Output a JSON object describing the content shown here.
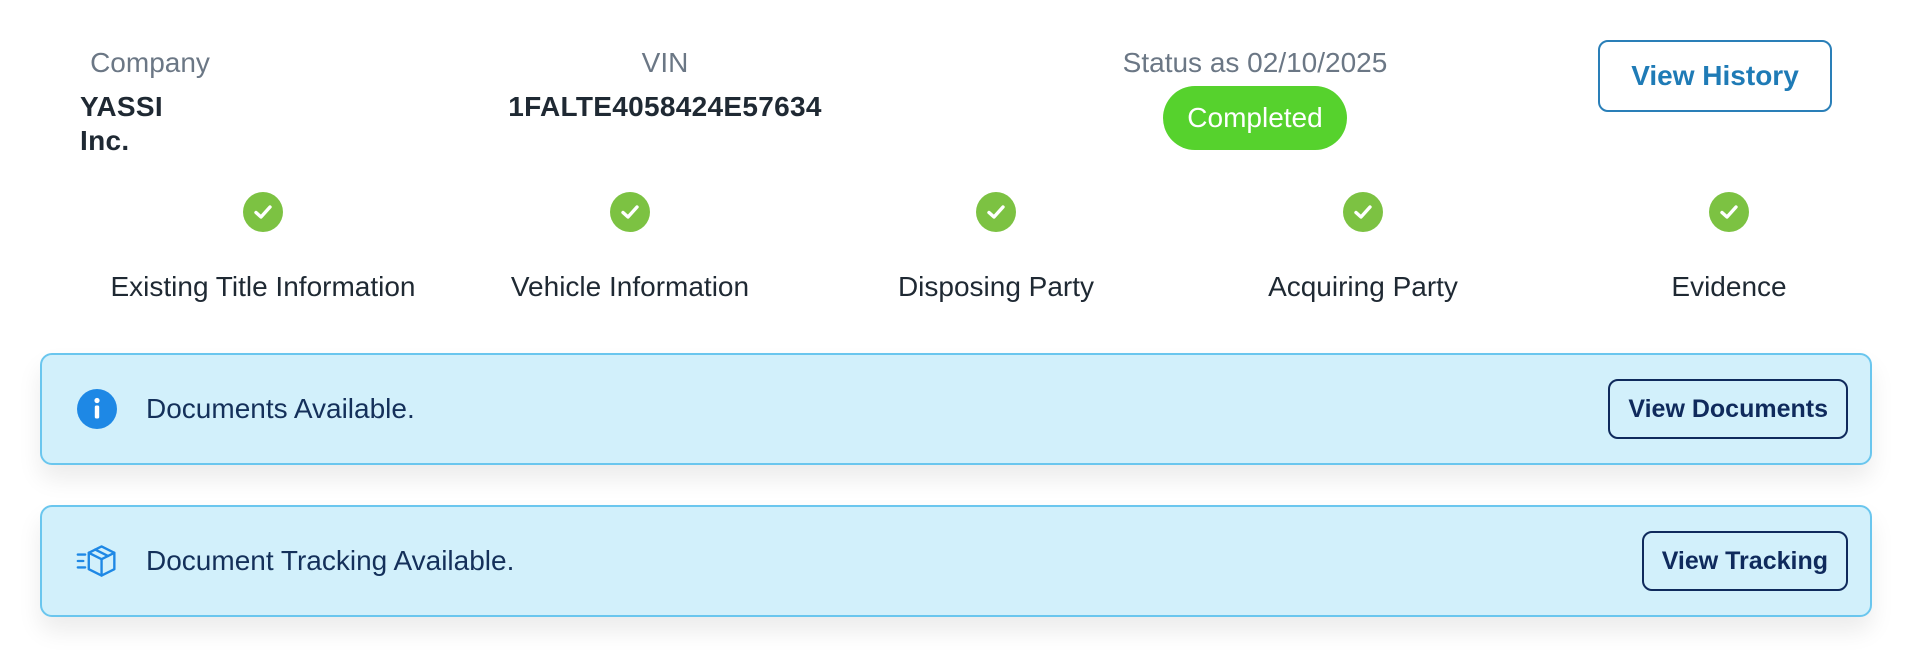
{
  "header": {
    "company_label": "Company",
    "company_value": "YASSI Inc.",
    "vin_label": "VIN",
    "vin_value": "1FALTE4058424E57634",
    "status_label": "Status as 02/10/2025",
    "status_badge": "Completed",
    "view_history_label": "View History"
  },
  "steps": [
    {
      "label": "Existing Title Information",
      "icon": "check-icon",
      "completed": true
    },
    {
      "label": "Vehicle Information",
      "icon": "check-icon",
      "completed": true
    },
    {
      "label": "Disposing Party",
      "icon": "check-icon",
      "completed": true
    },
    {
      "label": "Acquiring Party",
      "icon": "check-icon",
      "completed": true
    },
    {
      "label": "Evidence",
      "icon": "check-icon",
      "completed": true
    }
  ],
  "banners": {
    "documents": {
      "icon": "info-icon",
      "message": "Documents Available.",
      "button_label": "View Documents"
    },
    "tracking": {
      "icon": "package-tracking-icon",
      "message": "Document Tracking Available.",
      "button_label": "View Tracking"
    }
  },
  "colors": {
    "status_completed": "#56d22d",
    "step_check": "#7cc242",
    "banner_bg": "#d2f0fb",
    "banner_border": "#6ac6ee",
    "accent_blue": "#1f7bb6",
    "info_blue": "#1e88e5",
    "navy": "#0f2a5c"
  }
}
